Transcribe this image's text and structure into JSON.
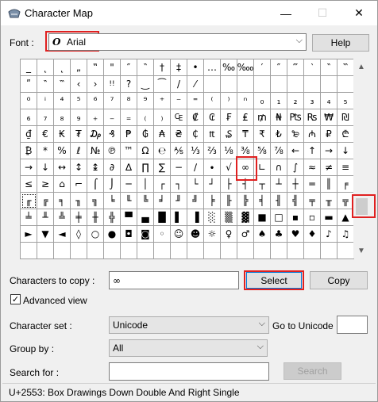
{
  "window": {
    "title": "Character Map",
    "minimize": "—",
    "maximize": "☐",
    "close": "✕"
  },
  "font": {
    "label": "Font :",
    "value": "Arial",
    "glyph": "O",
    "help": "Help"
  },
  "grid": {
    "rows": [
      [
        "_",
        "˛",
        "˛",
        "„",
        "‟",
        "\"",
        "″",
        "‶",
        "†",
        "‡",
        "•",
        "…",
        "‰",
        "‱",
        "′",
        "″",
        "‴",
        "‵",
        "‶",
        "‷"
      ],
      [
        "ʺ",
        "‶",
        "‷",
        "‹",
        "›",
        "!!",
        "?",
        "‿",
        "⁀",
        "/",
        "⁄",
        "",
        "",
        "",
        "",
        "",
        "",
        "",
        "",
        ""
      ],
      [
        "⁰",
        "ⁱ",
        "⁴",
        "⁵",
        "⁶",
        "⁷",
        "⁸",
        "⁹",
        "⁺",
        "⁻",
        "⁼",
        "⁽",
        "⁾",
        "ⁿ",
        "₀",
        "₁",
        "₂",
        "₃",
        "₄",
        "₅"
      ],
      [
        "₆",
        "₇",
        "₈",
        "₉",
        "₊",
        "₋",
        "₌",
        "₍",
        "₎",
        "₠",
        "₡",
        "₢",
        "₣",
        "₤",
        "₥",
        "₦",
        "₧",
        "₨",
        "₩",
        "₪"
      ],
      [
        "₫",
        "€",
        "₭",
        "₮",
        "₯",
        "₰",
        "₱",
        "₲",
        "₳",
        "₴",
        "₵",
        "₶",
        "₷",
        "₸",
        "₹",
        "₺",
        "₻",
        "₼",
        "₽",
        "₾"
      ],
      [
        "₿",
        "*",
        "%",
        "ℓ",
        "№",
        "℗",
        "™",
        "Ω",
        "℮",
        "⅍",
        "⅓",
        "⅔",
        "⅛",
        "⅜",
        "⅝",
        "⅞",
        "←",
        "↑",
        "→",
        "↓"
      ],
      [
        "→",
        "↓",
        "↔",
        "↕",
        "↨",
        "∂",
        "∆",
        "∏",
        "∑",
        "−",
        "∕",
        "∙",
        "√",
        "∞",
        "∟",
        "∩",
        "∫",
        "≈",
        "≠",
        "≡"
      ],
      [
        "≤",
        "≥",
        "⌂",
        "⌐",
        "⌠",
        "⌡",
        "─",
        "│",
        "┌",
        "┐",
        "└",
        "┘",
        "├",
        "┤",
        "┬",
        "┴",
        "┼",
        "═",
        "║",
        "╒"
      ],
      [
        "╓",
        "╔",
        "╕",
        "╖",
        "╗",
        "╘",
        "╙",
        "╚",
        "╛",
        "╜",
        "╝",
        "╞",
        "╟",
        "╠",
        "╡",
        "╢",
        "╣",
        "╤",
        "╥",
        "╦"
      ],
      [
        "╧",
        "╨",
        "╩",
        "╪",
        "╫",
        "╬",
        "▀",
        "▄",
        "█",
        "▌",
        "▐",
        "░",
        "▒",
        "▓",
        "■",
        "□",
        "▪",
        "▫",
        "▬",
        "▲"
      ],
      [
        "►",
        "▼",
        "◄",
        "◊",
        "○",
        "●",
        "◘",
        "◙",
        "◦",
        "☺",
        "☻",
        "☼",
        "♀",
        "♂",
        "♠",
        "♣",
        "♥",
        "♦",
        "♪",
        "♫"
      ],
      [
        "",
        "",
        "",
        "",
        "",
        "",
        "",
        "",
        "",
        "",
        "",
        "",
        "",
        "",
        "",
        "",
        "",
        "",
        "",
        ""
      ]
    ]
  },
  "copy": {
    "label": "Characters to copy :",
    "value": "∞",
    "select": "Select",
    "copy": "Copy"
  },
  "advanced": {
    "label": "Advanced view",
    "checked": "✓"
  },
  "charset": {
    "label": "Character set :",
    "value": "Unicode",
    "goto_label": "Go to Unicode :",
    "goto_value": ""
  },
  "groupby": {
    "label": "Group by :",
    "value": "All"
  },
  "search": {
    "label": "Search for :",
    "value": "",
    "button": "Search"
  },
  "status": {
    "text": "U+2553: Box Drawings Down Double And Right Single"
  }
}
